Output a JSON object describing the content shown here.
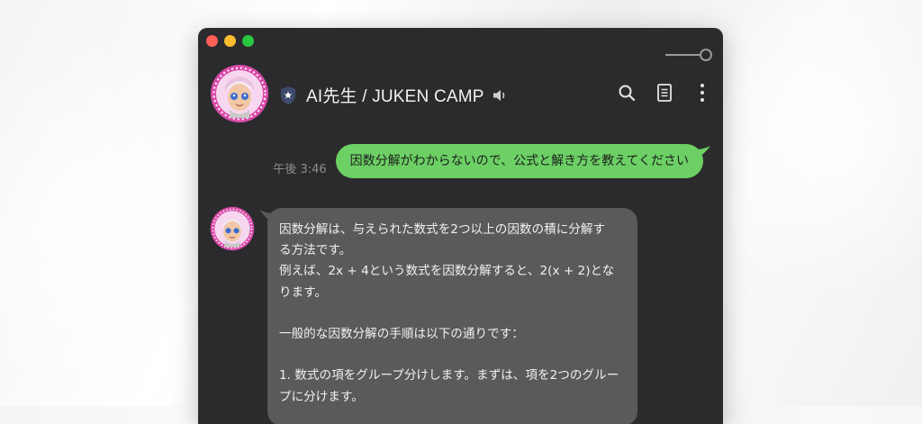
{
  "window": {
    "controls": [
      "close",
      "minimize",
      "zoom"
    ],
    "theme_colors": {
      "background": "#2b2b2d",
      "outgoing_bubble": "#6cd065",
      "incoming_bubble": "#5a5a5c"
    }
  },
  "header": {
    "title": "AI先生 / JUKEN CAMP",
    "badge_icon": "shield-star-icon",
    "speaker_icon": "speaker-icon",
    "actions": [
      "search-icon",
      "notes-icon",
      "more-vertical-icon"
    ]
  },
  "messages": {
    "outgoing": {
      "time": "午後 3:46",
      "text": "因数分解がわからないので、公式と解き方を教えてください"
    },
    "incoming": {
      "lines": [
        "因数分解は、与えられた数式を2つ以上の因数の積に分解す",
        "る方法です。",
        "例えば、2x + 4という数式を因数分解すると、2(x + 2)とな",
        "ります。",
        "",
        "一般的な因数分解の手順は以下の通りです：",
        "",
        "1. 数式の項をグループ分けします。まずは、項を2つのグルー",
        "プに分けます。"
      ]
    }
  }
}
